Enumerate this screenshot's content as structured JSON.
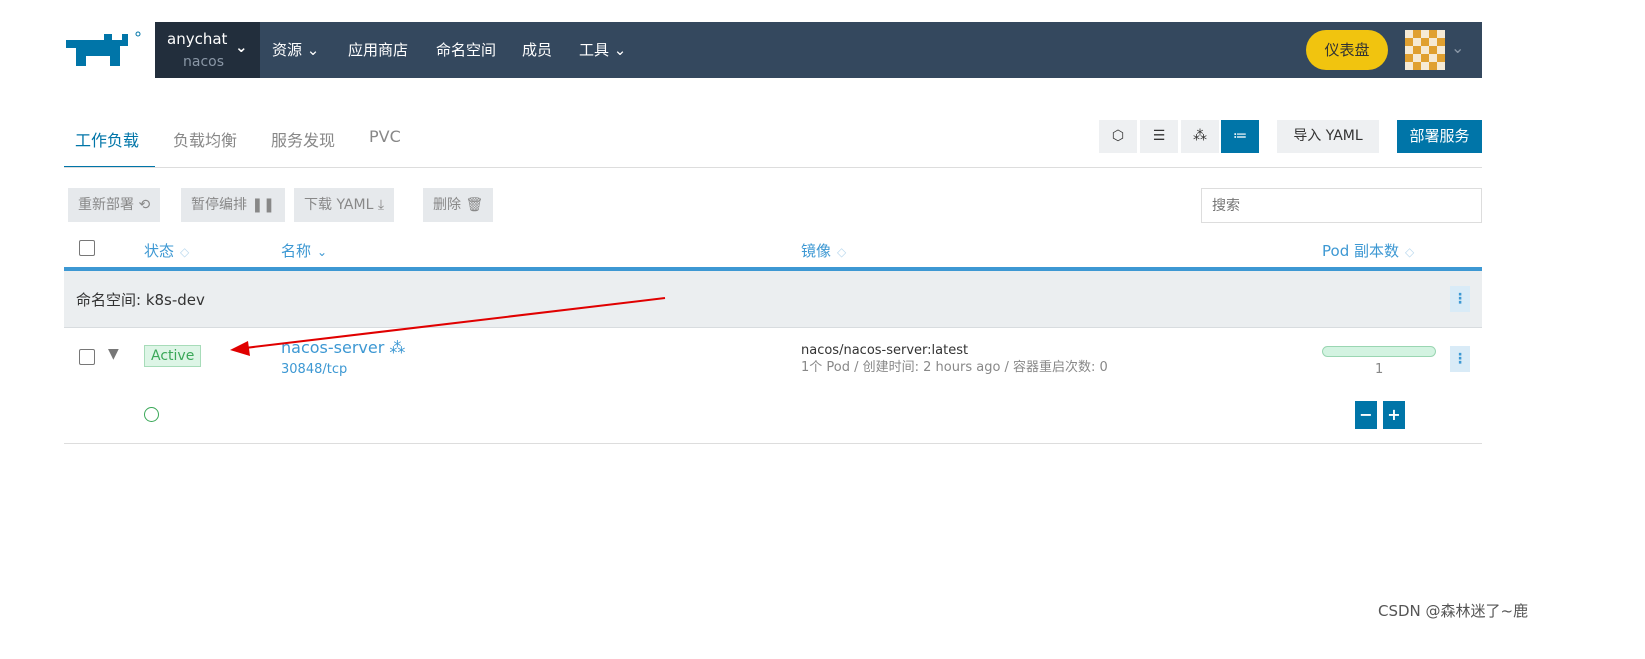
{
  "nav": {
    "project": "anychat",
    "namespace": "nacos",
    "items": [
      "资源",
      "应用商店",
      "命名空间",
      "成员",
      "工具"
    ],
    "dashboard": "仪表盘"
  },
  "tabs": [
    "工作负载",
    "负载均衡",
    "服务发现",
    "PVC"
  ],
  "toolbar": {
    "import_yaml": "导入 YAML",
    "deploy": "部署服务"
  },
  "actions": {
    "redeploy": "重新部署",
    "pause": "暂停编排",
    "download": "下载 YAML",
    "delete": "删除",
    "search_placeholder": "搜索"
  },
  "table": {
    "headers": {
      "state": "状态",
      "name": "名称",
      "image": "镜像",
      "pods": "Pod 副本数"
    },
    "group": "命名空间: k8s-dev",
    "rows": [
      {
        "state": "Active",
        "name": "nacos-server",
        "port": "30848/tcp",
        "image": "nacos/nacos-server:latest",
        "detail": "1个 Pod / 创建时间: 2 hours ago / 容器重启次数: 0",
        "pods": "1",
        "pod_fraction": 1
      }
    ]
  },
  "colors": {
    "nav": "#34485e",
    "accent": "#0075a8",
    "link": "#3d98d3",
    "dashboard": "#f1c40f",
    "annotation": "#e00000"
  },
  "watermark": "CSDN @森林迷了~鹿"
}
